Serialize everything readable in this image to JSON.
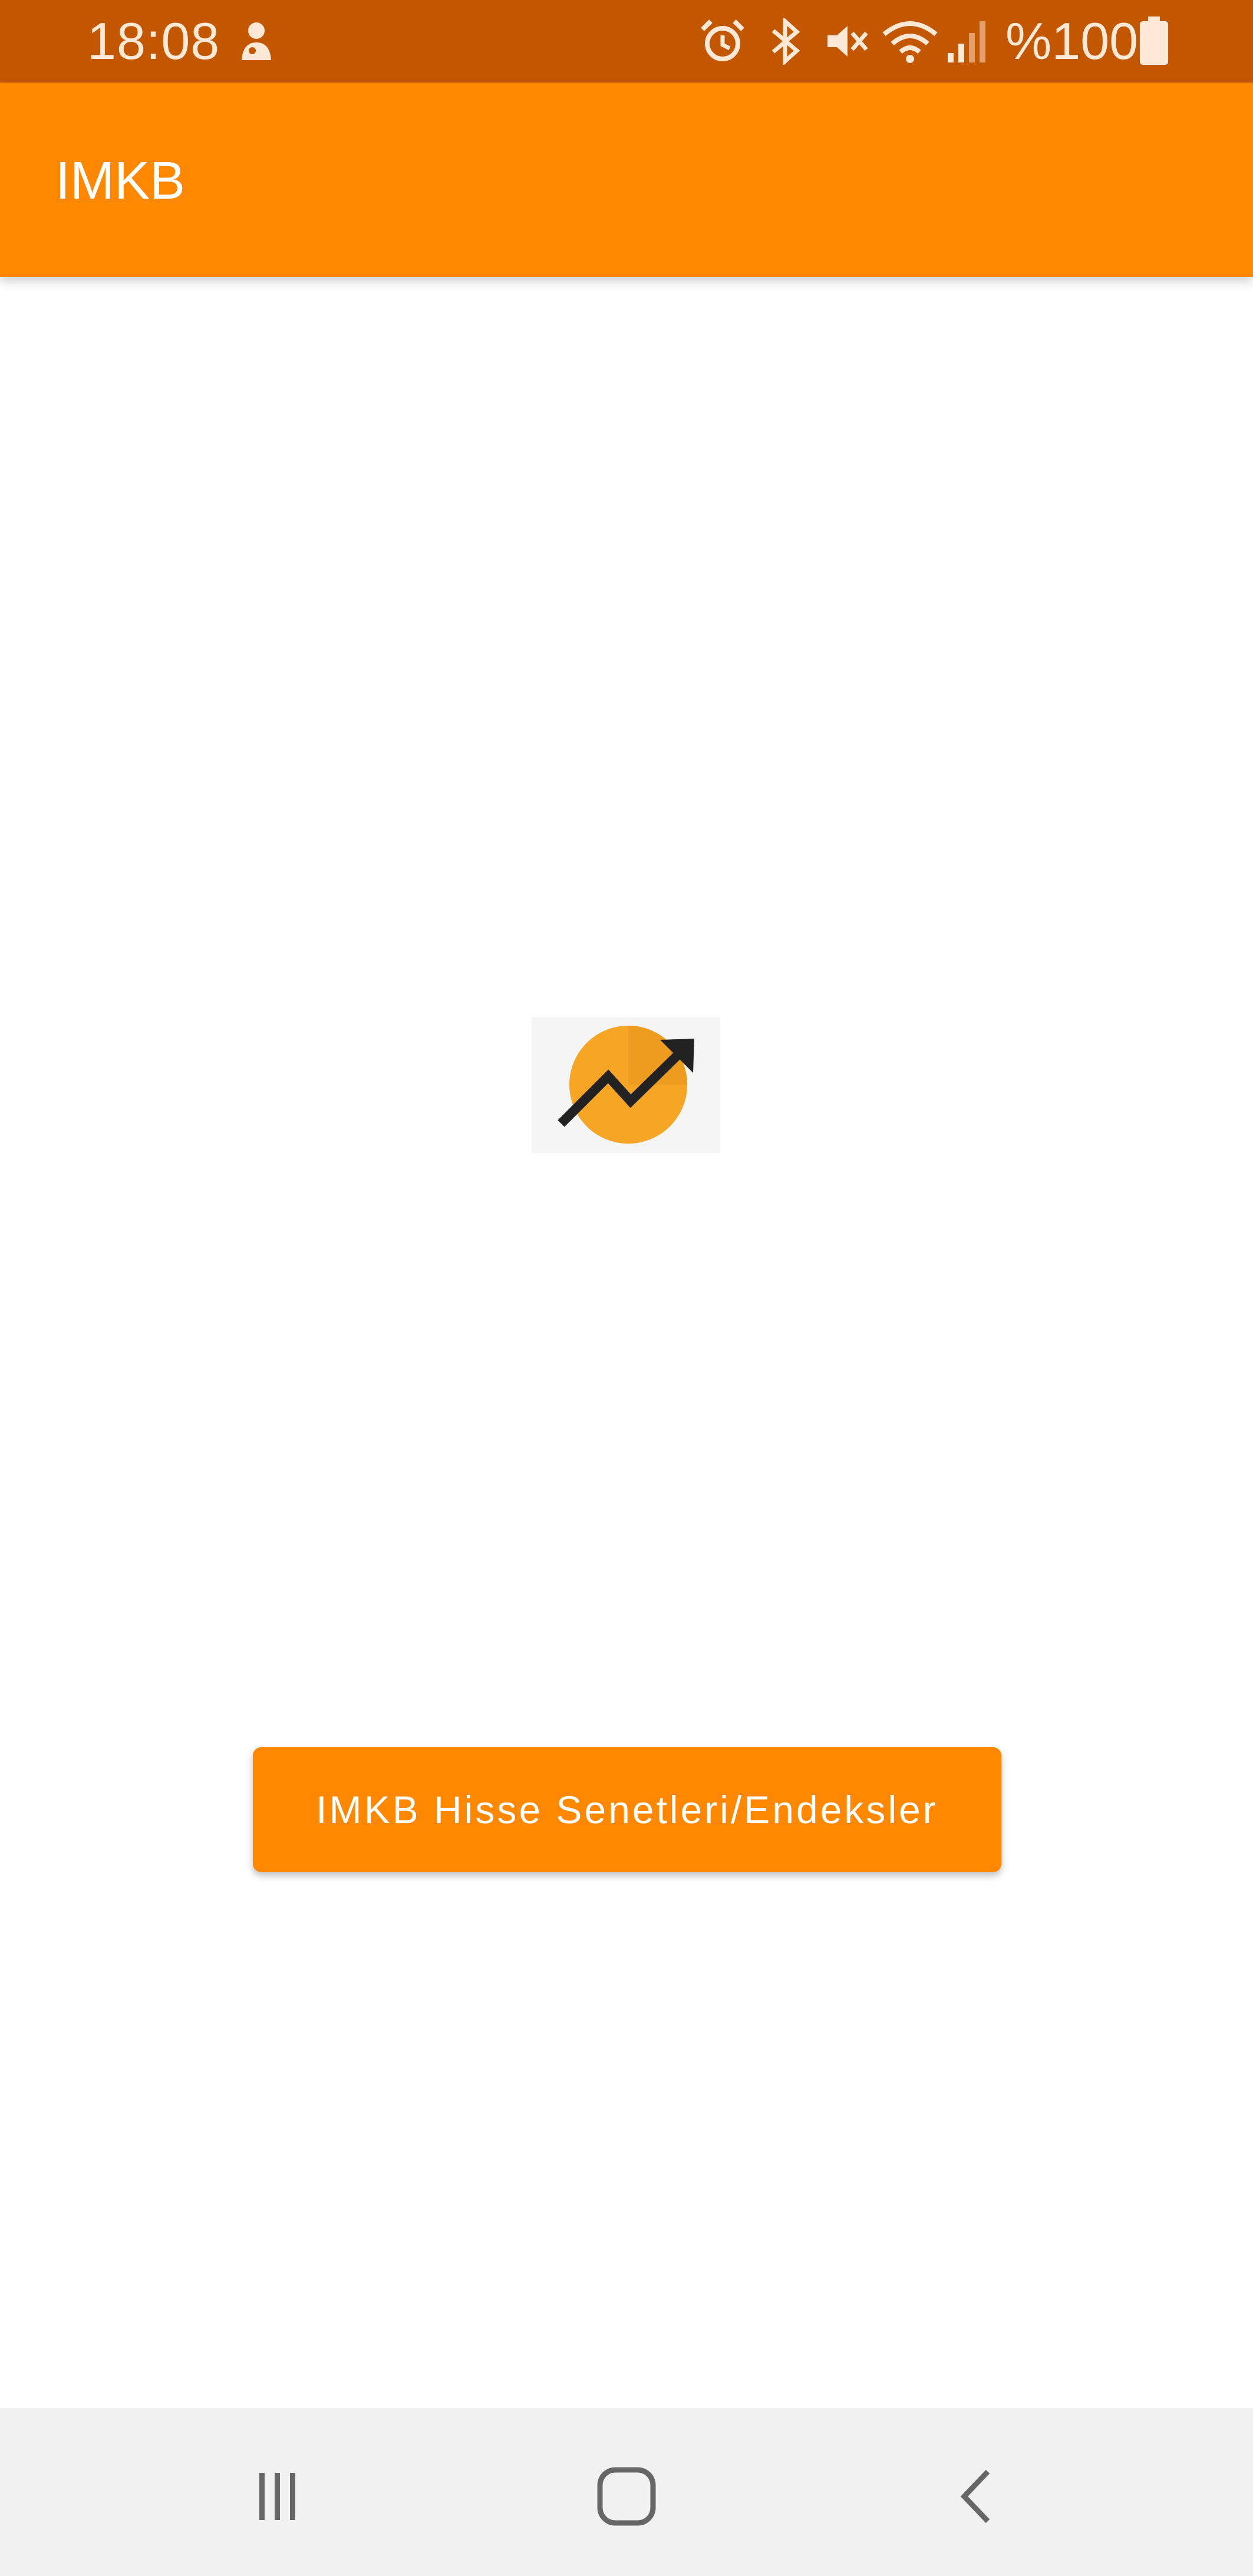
{
  "status_bar": {
    "time": "18:08",
    "battery_text": "%100",
    "icons": [
      "notification-icon",
      "alarm-icon",
      "bluetooth-icon",
      "mute-icon",
      "wifi-icon",
      "signal-icon",
      "battery-icon"
    ]
  },
  "app_bar": {
    "title": "IMKB",
    "color": "#FF8800",
    "status_color": "#C25700"
  },
  "main": {
    "logo": {
      "icon": "trending-up-icon",
      "circle_color": "#F7A524",
      "arrow_color": "#222222"
    },
    "button_label": "IMKB Hisse Senetleri/Endeksler"
  },
  "nav_bar": {
    "items": [
      "recent-apps-icon",
      "home-icon",
      "back-icon"
    ]
  }
}
